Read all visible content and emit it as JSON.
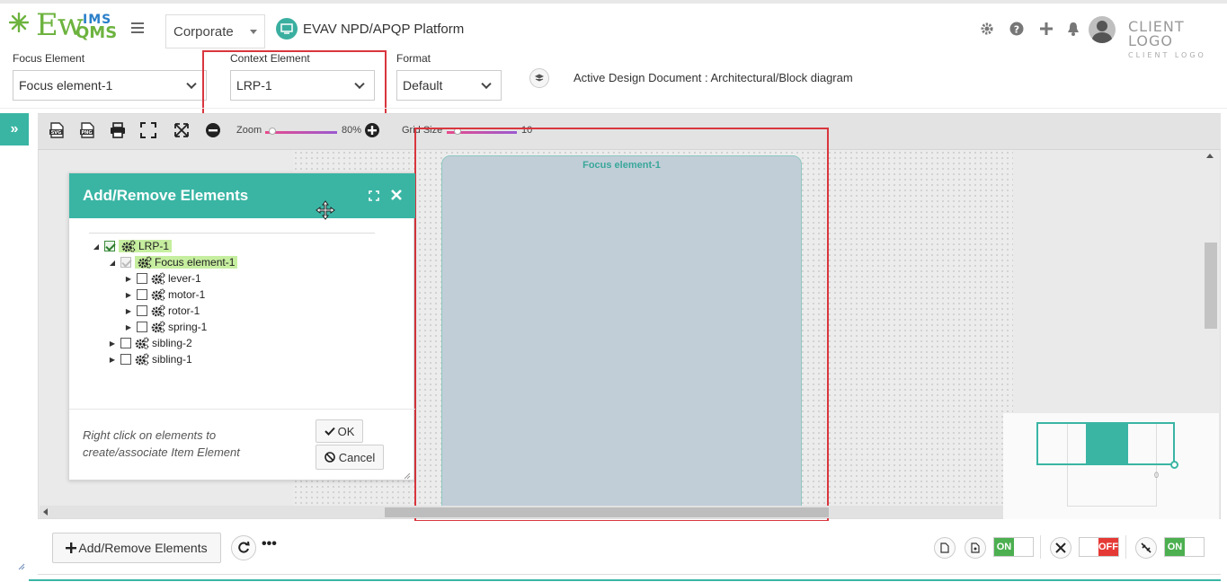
{
  "header": {
    "logo": {
      "word": "Ew",
      "ims": "IMS",
      "qms": "QMS"
    },
    "org_select": "Corporate",
    "platform_title": "EVAV NPD/APQP Platform",
    "client_logo": "CLIENT LOGO",
    "client_logo_sub": "CLIENT LOGO"
  },
  "selectors": {
    "focus_label": "Focus Element",
    "focus_value": "Focus element-1",
    "context_label": "Context Element",
    "context_value": "LRP-1",
    "format_label": "Format",
    "format_value": "Default",
    "active_doc": "Active Design Document : Architectural/Block diagram"
  },
  "toolbar": {
    "zoom_label": "Zoom",
    "zoom_value": "80%",
    "zoom_fraction": 0.1,
    "grid_label": "Grid Size",
    "grid_value": "10",
    "grid_fraction": 0.15
  },
  "canvas": {
    "focus_title": "Focus element-1",
    "minimap_label": "0"
  },
  "dialog": {
    "title": "Add/Remove Elements",
    "tree": [
      {
        "label": "LRP-1",
        "level": 0,
        "state": "checked",
        "highlight": true,
        "expanded": true
      },
      {
        "label": "Focus element-1",
        "level": 1,
        "state": "partial",
        "highlight": true,
        "expanded": true
      },
      {
        "label": "lever-1",
        "level": 2,
        "state": "unchecked",
        "highlight": false,
        "expanded": false
      },
      {
        "label": "motor-1",
        "level": 2,
        "state": "unchecked",
        "highlight": false,
        "expanded": false
      },
      {
        "label": "rotor-1",
        "level": 2,
        "state": "unchecked",
        "highlight": false,
        "expanded": false
      },
      {
        "label": "spring-1",
        "level": 2,
        "state": "unchecked",
        "highlight": false,
        "expanded": false
      },
      {
        "label": "sibling-2",
        "level": 1,
        "state": "unchecked",
        "highlight": false,
        "expanded": false
      },
      {
        "label": "sibling-1",
        "level": 1,
        "state": "unchecked",
        "highlight": false,
        "expanded": false
      }
    ],
    "hint": "Right click on elements to create/associate Item Element",
    "ok_label": "OK",
    "cancel_label": "Cancel"
  },
  "bottom": {
    "add_remove_label": "Add/Remove Elements",
    "toggle1": "ON",
    "toggle2": "OFF",
    "toggle3": "ON"
  },
  "colors": {
    "accent": "#3ab5a4",
    "highlight": "#c6ee9f",
    "alert_box": "#d9363e"
  }
}
